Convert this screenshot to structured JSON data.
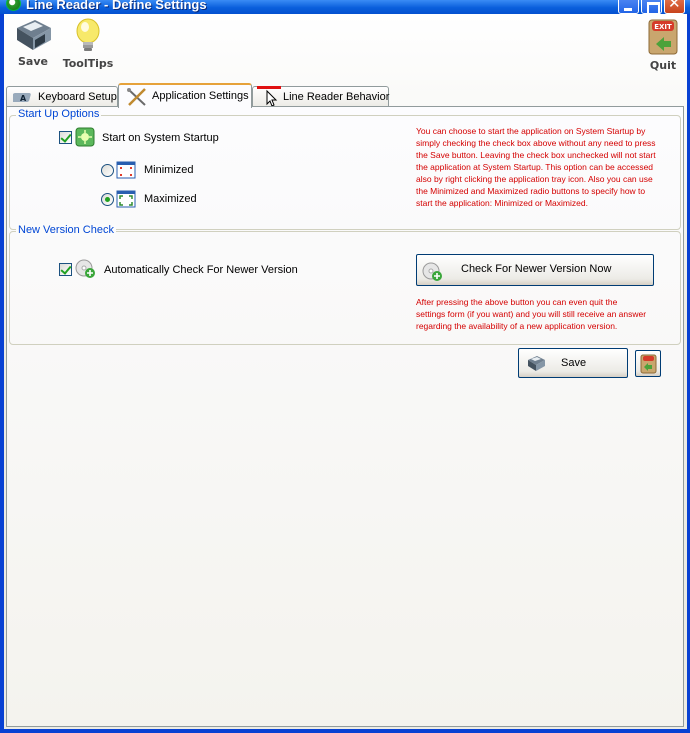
{
  "window": {
    "title": "Line Reader - Define Settings",
    "title_color": "#ffffff",
    "accent": "#0054e3"
  },
  "toolbar": {
    "save_label": "Save",
    "tooltips_label": "ToolTips",
    "quit_label": "Quit"
  },
  "tabs": [
    {
      "label": "Keyboard Setup",
      "icon": "keyboard-icon",
      "selected": false
    },
    {
      "label": "Application Settings",
      "icon": "tools-icon",
      "selected": true
    },
    {
      "label": "Line Reader Behavior",
      "icon": "pointer-icon",
      "selected": false
    }
  ],
  "startup": {
    "legend": "Start Up Options",
    "checkbox_label": "Start on System Startup",
    "checked": true,
    "minimized_label": "Minimized",
    "maximized_label": "Maximized",
    "selected_mode": "Maximized",
    "note": "You can choose to start the application on System Startup by simply checking the check box above without any need to press the Save button. Leaving the check box unchecked will not start the application at System Startup. This option can be accessed also by right clicking the application tray icon. Also you can use the Minimized and Maximized radio buttons to specify how to start the application: Minimized or Maximized."
  },
  "version": {
    "legend": "New Version Check",
    "checkbox_label": "Automatically Check For Newer Version",
    "checked": true,
    "button_label": "Check For Newer Version Now",
    "note": "After pressing the above button you can even quit the settings form (if you want) and you will still receive an answer regarding the availability of a new application version."
  },
  "footer": {
    "save_label": "Save"
  },
  "colors": {
    "legend": "#0046d5",
    "note": "#d40000",
    "selected_tab_border": "#e6a23a"
  }
}
